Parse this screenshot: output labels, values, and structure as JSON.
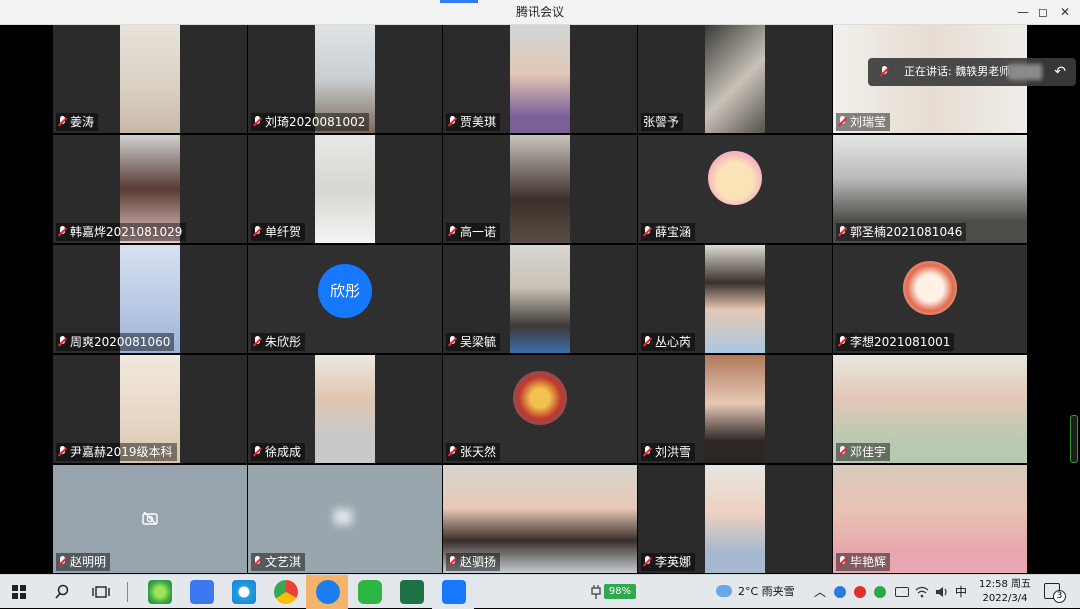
{
  "window": {
    "title": "腾讯会议",
    "controls": [
      "—",
      "◻",
      "✕"
    ]
  },
  "speaker": {
    "label": "正在讲话: 魏轶男老师;"
  },
  "participants": [
    {
      "name": "姜涛"
    },
    {
      "name": "刘琦2020081002"
    },
    {
      "name": "贾美琪"
    },
    {
      "name": "张謦予"
    },
    {
      "name": "刘瑞莹"
    },
    {
      "name": "韩嘉烨2021081029"
    },
    {
      "name": "单纤贺"
    },
    {
      "name": "高一诺"
    },
    {
      "name": "薛宝涵"
    },
    {
      "name": "郭圣楠2021081046"
    },
    {
      "name": "周爽2020081060"
    },
    {
      "name": "朱欣彤",
      "avatar_text": "欣彤"
    },
    {
      "name": "吴梁毓"
    },
    {
      "name": "丛心芮"
    },
    {
      "name": "李想2021081001"
    },
    {
      "name": "尹嘉赫2019级本科"
    },
    {
      "name": "徐成成"
    },
    {
      "name": "张天然"
    },
    {
      "name": "刘洪雪"
    },
    {
      "name": "邓佳宇"
    },
    {
      "name": "赵明明"
    },
    {
      "name": "文艺淇"
    },
    {
      "name": "赵驷扬"
    },
    {
      "name": "李英娜"
    },
    {
      "name": "毕艳辉"
    }
  ],
  "taskbar": {
    "battery": "98%",
    "weather": "2°C  雨夹雪",
    "ime": "中",
    "time": "12:58 周五",
    "date": "2022/3/4",
    "notifications": "3"
  },
  "colors": {
    "accent": "#1677ff",
    "titlebar": "#f3f3f3",
    "taskbar": "#e4e8ec"
  }
}
